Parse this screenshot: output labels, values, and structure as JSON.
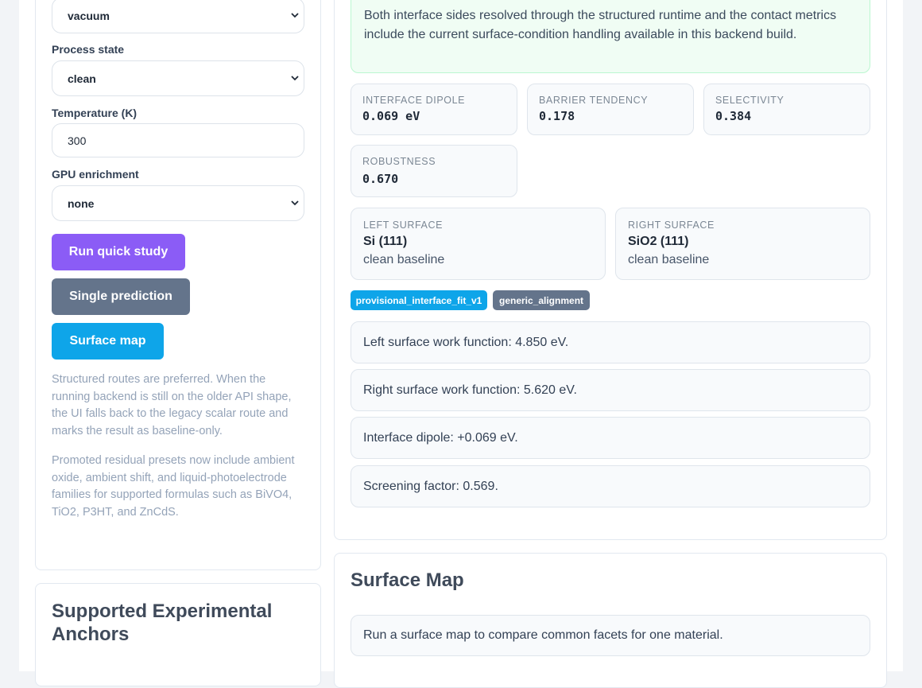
{
  "left_panel": {
    "environment_select_value": "vacuum",
    "process_state_label": "Process state",
    "process_state_value": "clean",
    "temperature_label": "Temperature (K)",
    "temperature_value": "300",
    "gpu_label": "GPU enrichment",
    "gpu_value": "none",
    "buttons": {
      "quick_study": "Run quick study",
      "single_prediction": "Single prediction",
      "surface_map": "Surface map"
    },
    "note_1": "Structured routes are preferred. When the running backend is still on the older API shape, the UI falls back to the legacy scalar route and marks the result as baseline-only.",
    "note_2": "Promoted residual presets now include ambient oxide, ambient shift, and liquid-photoelectrode families for supported formulas such as BiVO4, TiO2, P3HT, and ZnCdS."
  },
  "anchors_card": {
    "title": "Supported Experimental Anchors"
  },
  "result": {
    "banner_text": "Both interface sides resolved through the structured runtime and the contact metrics include the current surface-condition handling available in this backend build.",
    "metrics": [
      {
        "label": "INTERFACE DIPOLE",
        "value": "0.069 eV"
      },
      {
        "label": "BARRIER TENDENCY",
        "value": "0.178"
      },
      {
        "label": "SELECTIVITY",
        "value": "0.384"
      },
      {
        "label": "ROBUSTNESS",
        "value": "0.670"
      }
    ],
    "left_surface": {
      "label": "LEFT SURFACE",
      "name": "Si (111)",
      "state": "clean baseline"
    },
    "right_surface": {
      "label": "RIGHT SURFACE",
      "name": "SiO2 (111)",
      "state": "clean baseline"
    },
    "tags": [
      {
        "text": "provisional_interface_fit_v1",
        "color": "#0ea5e9"
      },
      {
        "text": "generic_alignment",
        "color": "#64748b"
      }
    ],
    "details": [
      "Left surface work function: 4.850 eV.",
      "Right surface work function: 5.620 eV.",
      "Interface dipole: +0.069 eV.",
      "Screening factor: 0.569."
    ]
  },
  "surface_map": {
    "title": "Surface Map",
    "empty_text": "Run a surface map to compare common facets for one material."
  },
  "colors": {
    "primary": "#8b5cf6",
    "secondary": "#64748b",
    "accent": "#0ea5e9",
    "success_bg": "#f0fdf4",
    "success_border": "#bbf7d0"
  }
}
